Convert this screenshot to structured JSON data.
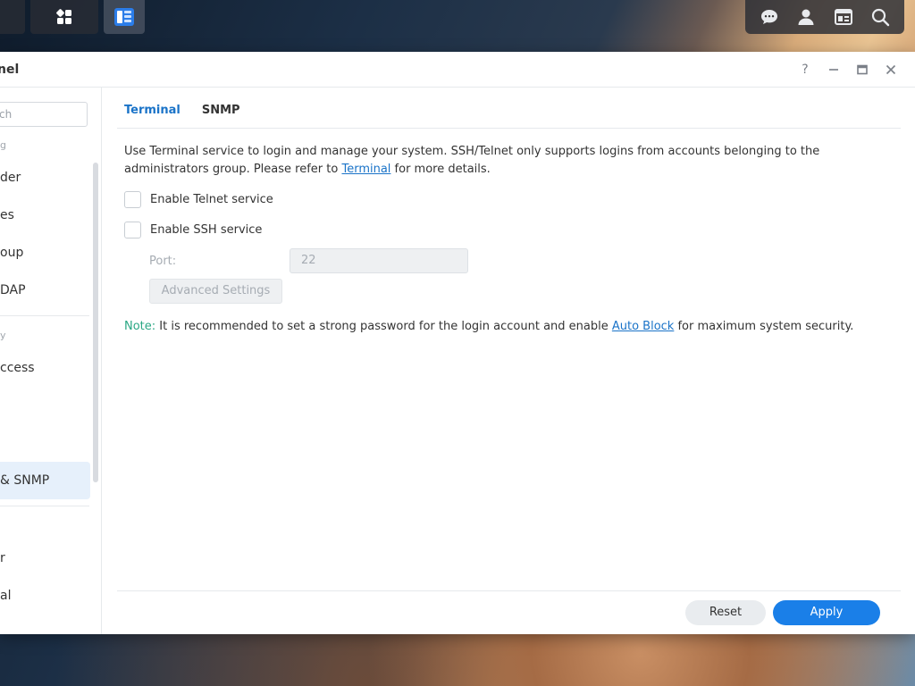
{
  "window": {
    "title": "nel"
  },
  "title_controls": {
    "help": "?",
    "minimize": "—",
    "close": "✕"
  },
  "sidebar": {
    "search_text": "ch",
    "groups": [
      {
        "label": "g"
      },
      {
        "label": "y"
      }
    ],
    "items": [
      {
        "label": "der"
      },
      {
        "label": "es"
      },
      {
        "label": "oup"
      },
      {
        "label": "DAP"
      },
      {
        "label": "ccess"
      },
      {
        "label": "& SNMP",
        "active": true
      },
      {
        "label": "r"
      },
      {
        "label": "al"
      }
    ]
  },
  "tabs": [
    {
      "label": "Terminal",
      "active": true
    },
    {
      "label": "SNMP",
      "active": false
    }
  ],
  "content": {
    "desc_pre": "Use Terminal service to login and manage your system. SSH/Telnet only supports logins from accounts belonging to the administrators group. Please refer to ",
    "desc_link": "Terminal",
    "desc_post": " for more details.",
    "telnet_label": "Enable Telnet service",
    "ssh_label": "Enable SSH service",
    "port_label": "Port:",
    "port_value": "22",
    "advanced_label": "Advanced Settings",
    "note_label": "Note:",
    "note_pre": " It is recommended to set a strong password for the login account and enable ",
    "note_link": "Auto Block",
    "note_post": " for maximum system security."
  },
  "footer": {
    "reset_label": "Reset",
    "apply_label": "Apply"
  },
  "colors": {
    "accent": "#1a73c8",
    "apply": "#1a7fe8",
    "note": "#2aa784"
  }
}
